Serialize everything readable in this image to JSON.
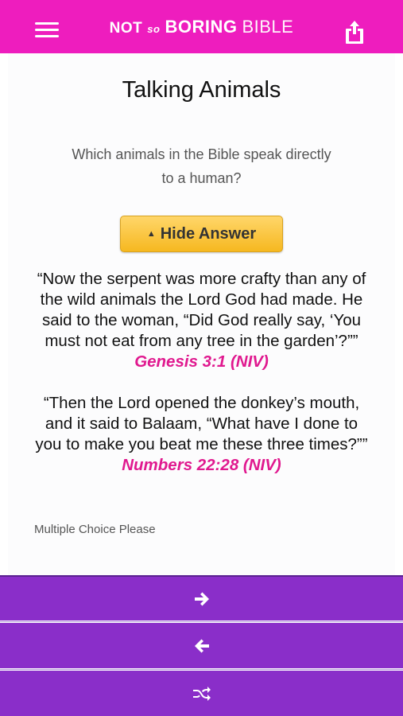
{
  "header": {
    "brand_part1": "Not",
    "brand_part2": "so",
    "brand_part3": "BORING",
    "brand_part4": "BIBLE",
    "menu_icon": "hamburger-icon",
    "share_icon": "share-icon",
    "bg_color": "#ee1dbe"
  },
  "question": {
    "title": "Talking Animals",
    "text": "Which animals in the Bible speak directly to a human?"
  },
  "answer_button": {
    "label": "Hide Answer",
    "caret": "▲"
  },
  "answers": [
    {
      "quote": "“Now the serpent was more crafty than any of the wild animals the Lord God had made. He said to the woman, “Did God really say, ‘You must not eat from any tree in the garden’?”” ",
      "reference": "Genesis 3:1 (NIV)"
    },
    {
      "quote": "“Then the Lord opened the donkey’s mouth, and it said to Balaam, “What have I done to you to make you beat me these three times?”” ",
      "reference": "Numbers 22:28 (NIV)"
    }
  ],
  "multiple_choice_link": "Multiple Choice Please",
  "nav": {
    "next_icon": "arrow-right-icon",
    "prev_icon": "arrow-left-icon",
    "shuffle_icon": "shuffle-icon",
    "bg_color": "#8a2ec9"
  },
  "colors": {
    "reference": "#e0198f",
    "button": "#f6b820"
  }
}
